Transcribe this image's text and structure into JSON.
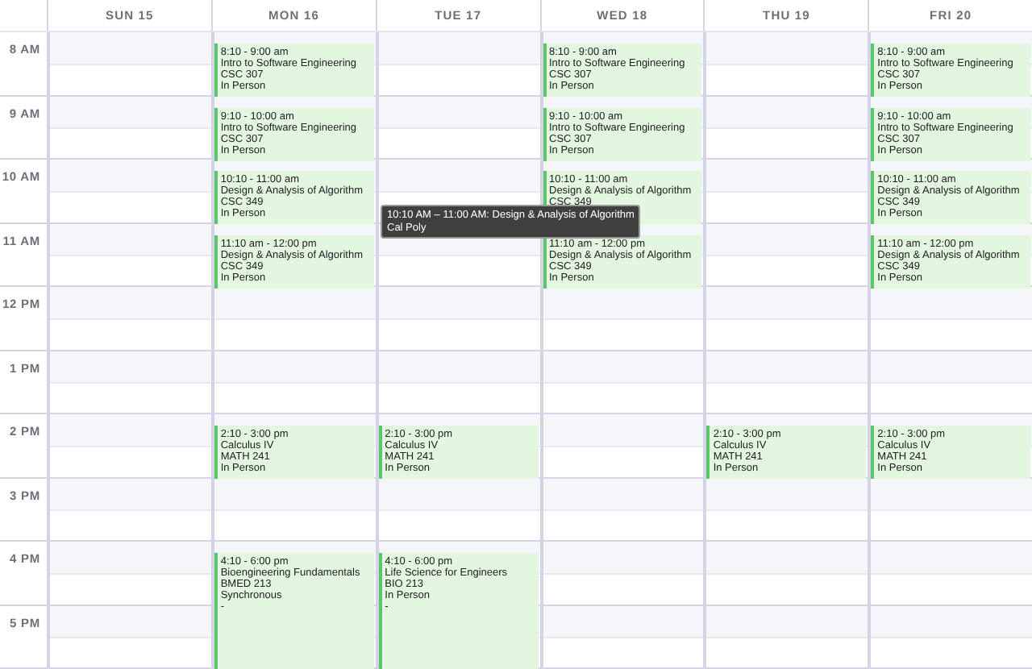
{
  "days": [
    {
      "label": "SUN 15"
    },
    {
      "label": "MON 16"
    },
    {
      "label": "TUE 17"
    },
    {
      "label": "WED 18"
    },
    {
      "label": "THU 19"
    },
    {
      "label": "FRI 20"
    }
  ],
  "rows": [
    {
      "label": "8 AM",
      "cells": [
        {},
        {
          "kind": "hour",
          "lines": [
            "8:10 - 9:00 am",
            "Intro to Software Engineering",
            "CSC 307",
            "In Person"
          ]
        },
        {},
        {
          "kind": "hour",
          "lines": [
            "8:10 - 9:00 am",
            "Intro to Software Engineering",
            "CSC 307",
            "In Person"
          ]
        },
        {},
        {
          "kind": "hour",
          "lines": [
            "8:10 - 9:00 am",
            "Intro to Software Engineering",
            "CSC 307",
            "In Person"
          ]
        }
      ]
    },
    {
      "label": "9 AM",
      "cells": [
        {},
        {
          "kind": "hour",
          "lines": [
            "9:10 - 10:00 am",
            "Intro to Software Engineering",
            "CSC 307",
            "In Person"
          ]
        },
        {},
        {
          "kind": "hour",
          "lines": [
            "9:10 - 10:00 am",
            "Intro to Software Engineering",
            "CSC 307",
            "In Person"
          ]
        },
        {},
        {
          "kind": "hour",
          "lines": [
            "9:10 - 10:00 am",
            "Intro to Software Engineering",
            "CSC 307",
            "In Person"
          ]
        }
      ]
    },
    {
      "label": "10 AM",
      "cells": [
        {},
        {
          "kind": "hour",
          "lines": [
            "10:10 - 11:00 am",
            "Design & Analysis of Algorithm",
            "CSC 349",
            "In Person"
          ]
        },
        {},
        {
          "kind": "hour",
          "lines": [
            "10:10 - 11:00 am",
            "Design & Analysis of Algorithm",
            "CSC 349"
          ]
        },
        {},
        {
          "kind": "hour",
          "lines": [
            "10:10 - 11:00 am",
            "Design & Analysis of Algorithm",
            "CSC 349",
            "In Person"
          ]
        }
      ]
    },
    {
      "label": "11 AM",
      "cells": [
        {},
        {
          "kind": "hour",
          "lines": [
            "11:10 am - 12:00 pm",
            "Design & Analysis of Algorithm",
            "CSC 349",
            "In Person"
          ]
        },
        {},
        {
          "kind": "hour",
          "lines": [
            "11:10 am - 12:00 pm",
            "Design & Analysis of Algorithm",
            "CSC 349",
            "In Person"
          ]
        },
        {},
        {
          "kind": "hour",
          "lines": [
            "11:10 am - 12:00 pm",
            "Design & Analysis of Algorithm",
            "CSC 349",
            "In Person"
          ]
        }
      ]
    },
    {
      "label": "12 PM",
      "cells": [
        {},
        {},
        {},
        {},
        {},
        {}
      ]
    },
    {
      "label": "1 PM",
      "cells": [
        {},
        {},
        {},
        {},
        {},
        {}
      ]
    },
    {
      "label": "2 PM",
      "cells": [
        {},
        {
          "kind": "hour",
          "lines": [
            "2:10 - 3:00 pm",
            "Calculus IV",
            "MATH 241",
            "In Person"
          ]
        },
        {
          "kind": "hour",
          "lines": [
            "2:10 - 3:00 pm",
            "Calculus IV",
            "MATH 241",
            "In Person"
          ]
        },
        {},
        {
          "kind": "hour",
          "lines": [
            "2:10 - 3:00 pm",
            "Calculus IV",
            "MATH 241",
            "In Person"
          ]
        },
        {
          "kind": "hour",
          "lines": [
            "2:10 - 3:00 pm",
            "Calculus IV",
            "MATH 241",
            "In Person"
          ]
        }
      ]
    },
    {
      "label": "3 PM",
      "cells": [
        {},
        {},
        {},
        {},
        {},
        {}
      ]
    },
    {
      "label": "4 PM",
      "cells": [
        {},
        {
          "kind": "long",
          "lines": [
            "4:10 - 6:00 pm",
            "Bioengineering Fundamentals",
            "BMED 213",
            "Synchronous",
            "-"
          ]
        },
        {
          "kind": "long",
          "lines": [
            "4:10 - 6:00 pm",
            "Life Science for Engineers",
            "BIO 213",
            "In Person",
            "-"
          ]
        },
        {},
        {},
        {}
      ]
    },
    {
      "label": "5 PM",
      "cells": [
        {},
        {},
        {},
        {},
        {},
        {}
      ]
    }
  ],
  "tooltip": {
    "lines": [
      "10:10 AM – 11:00 AM: Design & Analysis of Algorithm",
      "Cal Poly"
    ]
  }
}
